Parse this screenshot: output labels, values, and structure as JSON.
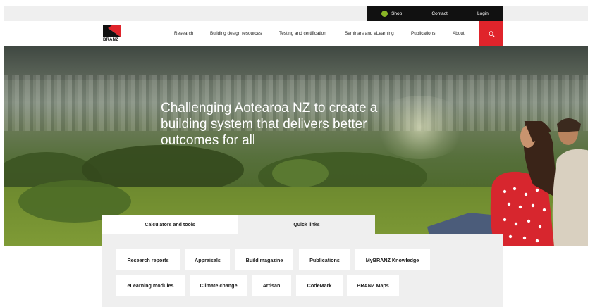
{
  "utility": {
    "shop": "Shop",
    "contact": "Contact",
    "login": "Login"
  },
  "logo": {
    "text": "BRANZ"
  },
  "nav": {
    "items": [
      {
        "label": "Research"
      },
      {
        "label": "Building design resources"
      },
      {
        "label": "Testing and certification"
      },
      {
        "label": "Seminars and eLearning"
      },
      {
        "label": "Publications"
      },
      {
        "label": "About"
      }
    ]
  },
  "hero": {
    "title": "Challenging Aotearoa NZ to create a building system that delivers better outcomes for all"
  },
  "tabs": [
    {
      "label": "Calculators and tools",
      "active": true
    },
    {
      "label": "Quick links",
      "active": false
    }
  ],
  "quick_links": [
    {
      "label": "Research reports"
    },
    {
      "label": "Appraisals"
    },
    {
      "label": "Build magazine"
    },
    {
      "label": "Publications"
    },
    {
      "label": "MyBRANZ Knowledge"
    },
    {
      "label": "eLearning modules"
    },
    {
      "label": "Climate change"
    },
    {
      "label": "Artisan"
    },
    {
      "label": "CodeMark"
    },
    {
      "label": "BRANZ Maps"
    }
  ],
  "colors": {
    "accent_red": "#e0242b",
    "utility_bg": "#111111",
    "shop_dot": "#8ab526",
    "panel_bg": "#efefef"
  }
}
